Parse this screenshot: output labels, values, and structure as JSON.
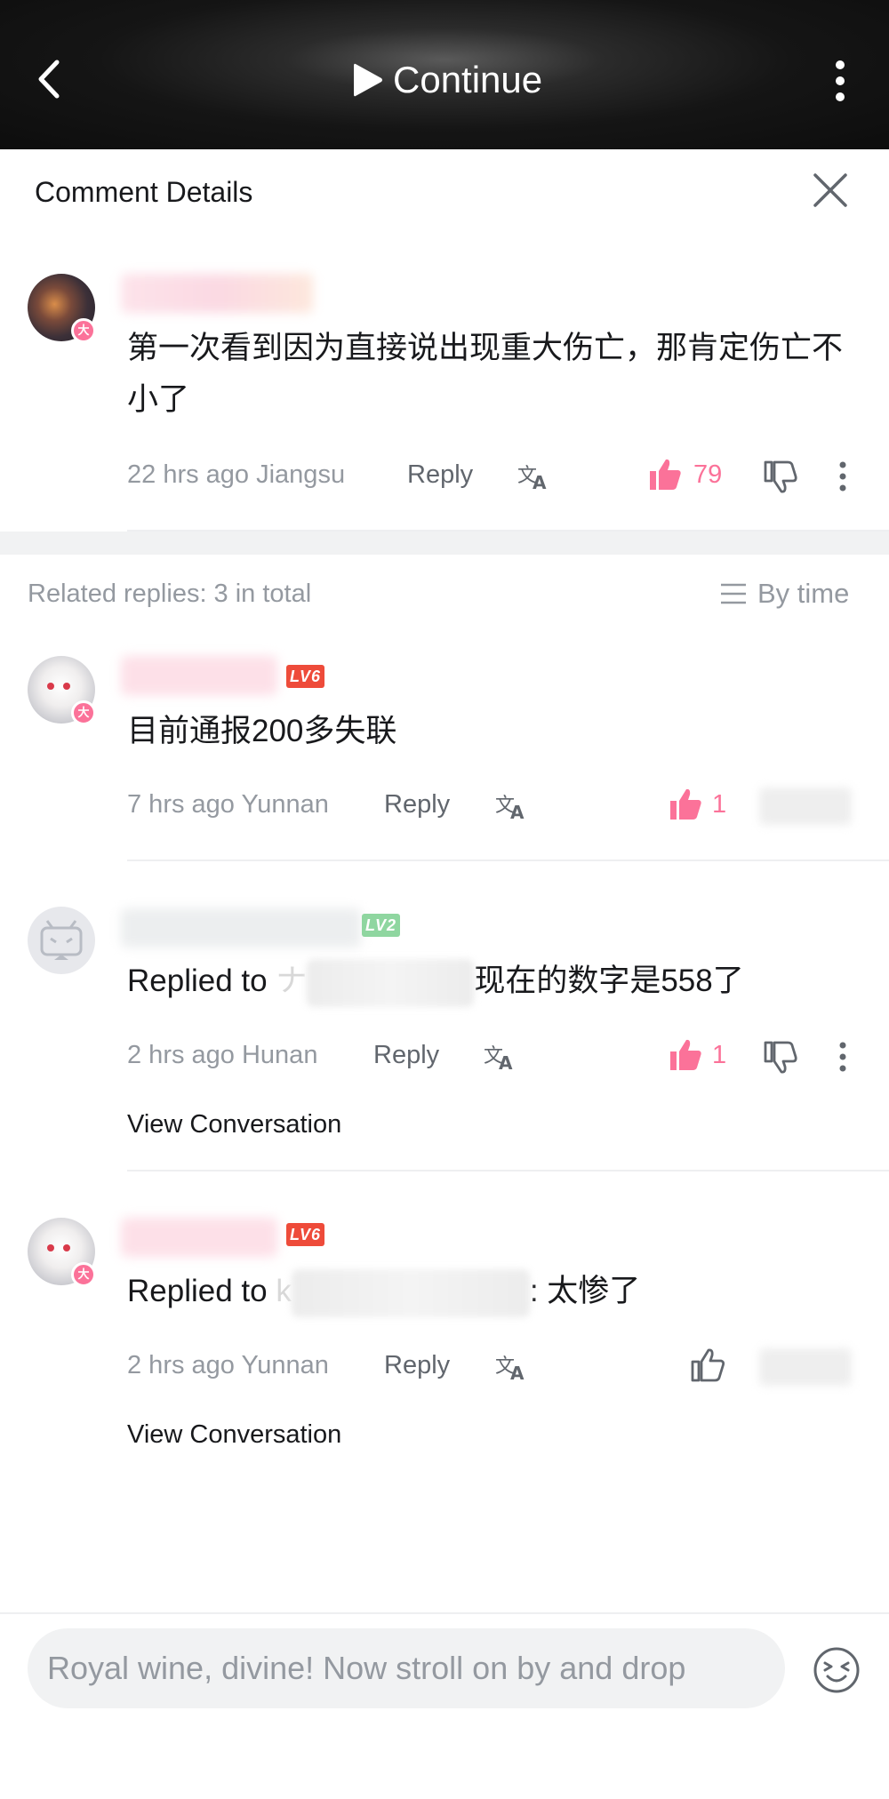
{
  "top_bar": {
    "continue_label": "Continue"
  },
  "panel": {
    "title": "Comment Details"
  },
  "main_comment": {
    "text": "第一次看到因为直接说出现重大伤亡，那肯定伤亡不小了",
    "time": "22 hrs ago",
    "location": "Jiangsu",
    "reply_label": "Reply",
    "likes": "79"
  },
  "replies_header": {
    "count_label": "Related replies: 3 in total",
    "sort_label": "By time"
  },
  "replies": [
    {
      "level": "LV6",
      "text": "目前通报200多失联",
      "time": "7 hrs ago",
      "location": "Yunnan",
      "reply_label": "Reply",
      "likes": "1"
    },
    {
      "level": "LV2",
      "replied_prefix": "Replied to ",
      "replied_visible_char": "ナ",
      "text": "现在的数字是558了",
      "time": "2 hrs ago",
      "location": "Hunan",
      "reply_label": "Reply",
      "likes": "1",
      "view_conversation": "View Conversation"
    },
    {
      "level": "LV6",
      "replied_prefix": "Replied to ",
      "replied_visible_char": "k",
      "text": ": 太惨了",
      "time": "2 hrs ago",
      "location": "Yunnan",
      "reply_label": "Reply",
      "view_conversation": "View Conversation"
    }
  ],
  "input": {
    "placeholder": "Royal wine, divine! Now stroll on by and drop"
  },
  "colors": {
    "accent_pink": "#fb7299",
    "level6": "#ee4b3a",
    "level2": "#8fd6a0"
  }
}
